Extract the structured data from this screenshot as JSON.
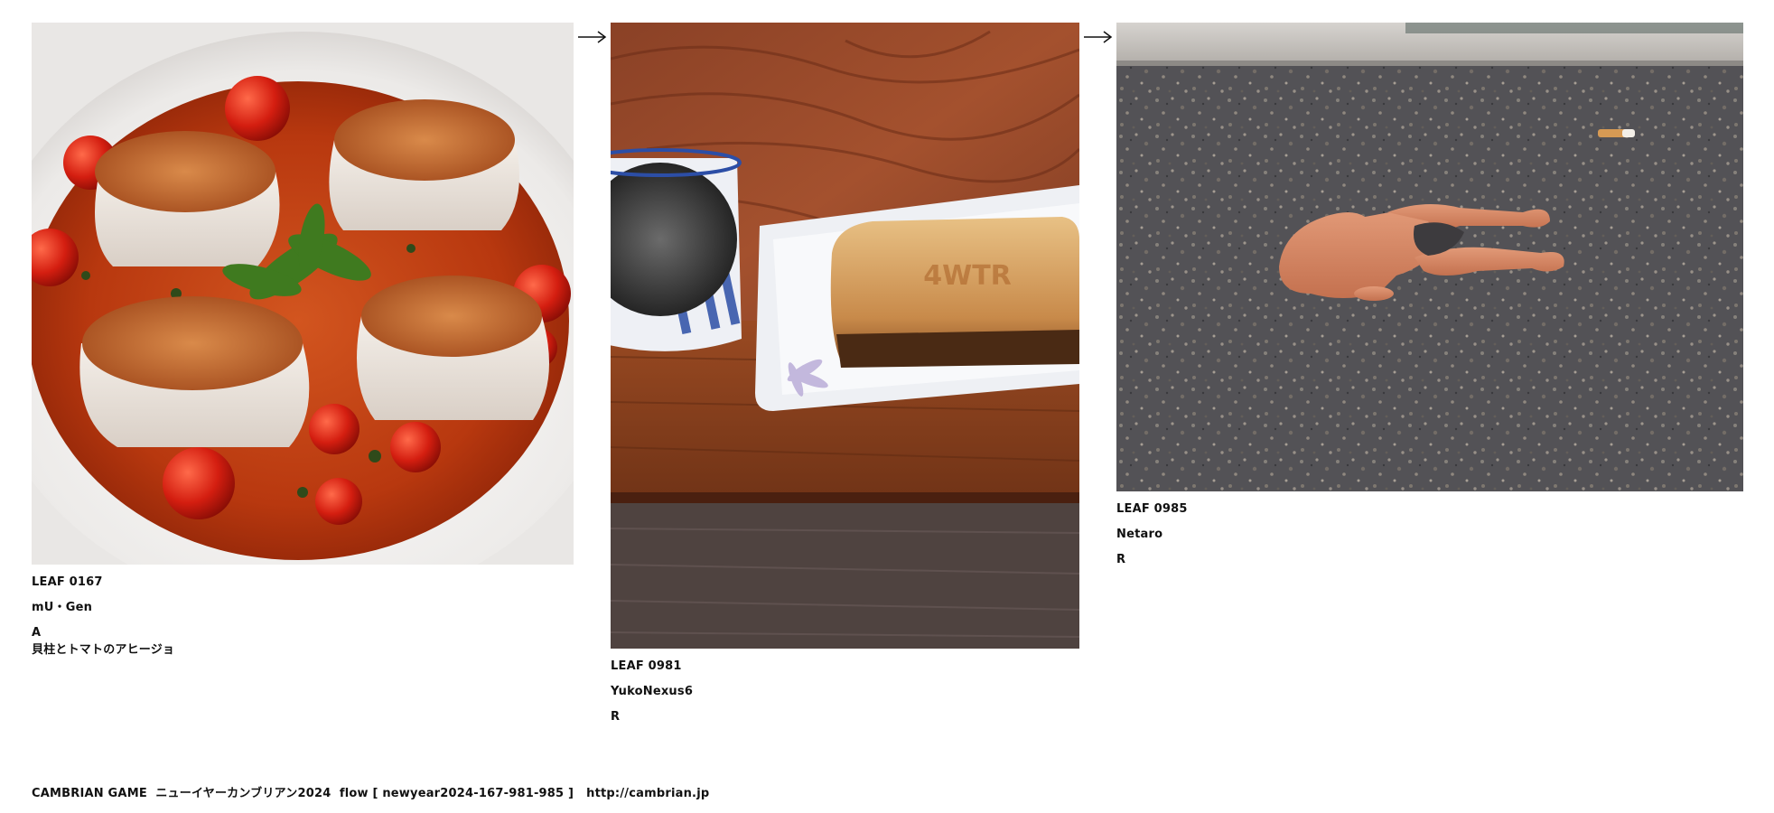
{
  "leaves": [
    {
      "id": "LEAF 0167",
      "author": "mU・Gen",
      "tag": "A",
      "note": "貝柱とトマトのアヒージョ"
    },
    {
      "id": "LEAF 0981",
      "author": "YukoNexus6",
      "tag": "R"
    },
    {
      "id": "LEAF 0985",
      "author": "Netaro",
      "tag": "R"
    }
  ],
  "arrows": [
    "arrow-right-icon",
    "arrow-right-icon"
  ],
  "footer": {
    "title": "CAMBRIAN GAME  ニューイヤーカンブリアン2024  flow [ newyear2024-167-981-985 ]",
    "url": "http://cambrian.jp"
  }
}
